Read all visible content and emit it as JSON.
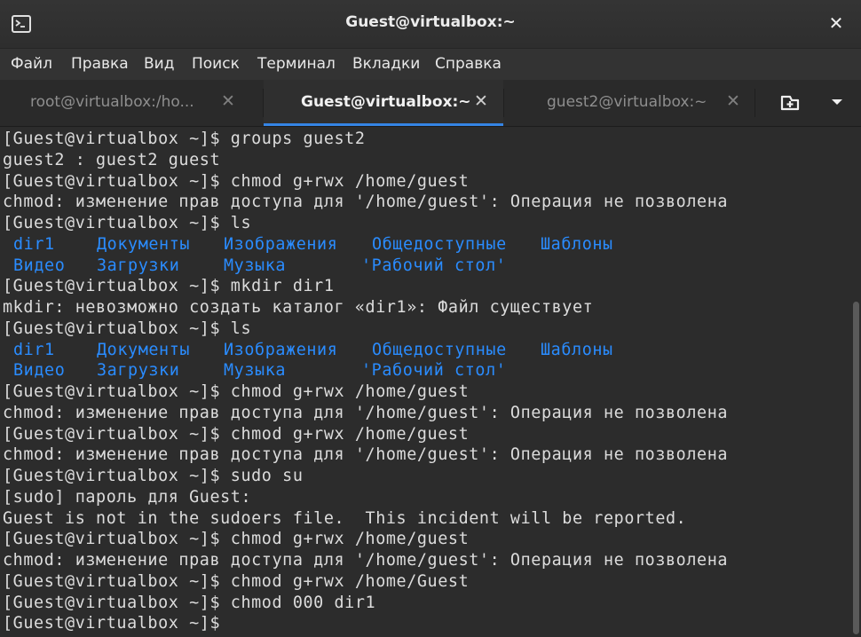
{
  "window": {
    "title": "Guest@virtualbox:~",
    "icon": "terminal-icon",
    "close_label": "✕"
  },
  "menu": [
    "Файл",
    "Правка",
    "Вид",
    "Поиск",
    "Терминал",
    "Вкладки",
    "Справка"
  ],
  "tabs": [
    {
      "label": "root@virtualbox:/ho...",
      "active": false,
      "close": "✕"
    },
    {
      "label": "Guest@virtualbox:~",
      "active": true,
      "close": "✕"
    },
    {
      "label": "guest2@virtualbox:~",
      "active": false,
      "close": "✕"
    }
  ],
  "tab_controls": {
    "new_tab_icon": "new-tab-icon",
    "menu_icon": "chevron-down-icon"
  },
  "colors": {
    "directory": "#2a8cff",
    "text": "#dcdcdc",
    "background": "#2c2c2c",
    "accent": "#3584e4"
  },
  "terminal": {
    "lines": [
      "[Guest@virtualbox ~]$ groups guest2",
      "guest2 : guest2 guest",
      "[Guest@virtualbox ~]$ chmod g+rwx /home/guest",
      "chmod: изменение прав доступа для '/home/guest': Операция не позволена",
      "[Guest@virtualbox ~]$ ls",
      "",
      "",
      "[Guest@virtualbox ~]$ mkdir dir1",
      "mkdir: невозможно создать каталог «dir1»: Файл существует",
      "[Guest@virtualbox ~]$ ls",
      "",
      "",
      "[Guest@virtualbox ~]$ chmod g+rwx /home/guest",
      "chmod: изменение прав доступа для '/home/guest': Операция не позволена",
      "[Guest@virtualbox ~]$ chmod g+rwx /home/guest",
      "chmod: изменение прав доступа для '/home/guest': Операция не позволена",
      "[Guest@virtualbox ~]$ sudo su",
      "[sudo] пароль для Guest:",
      "Guest is not in the sudoers file.  This incident will be reported.",
      "[Guest@virtualbox ~]$ chmod g+rwx /home/guest",
      "chmod: изменение прав доступа для '/home/guest': Операция не позволена",
      "[Guest@virtualbox ~]$ chmod g+rwx /home/Guest",
      "[Guest@virtualbox ~]$ chmod 000 dir1",
      "[Guest@virtualbox ~]$ "
    ],
    "ls_output": [
      [
        "dir1",
        "Документы",
        "Изображения",
        "Общедоступные",
        "Шаблоны"
      ],
      [
        "Видео",
        "Загрузки",
        "Музыка",
        "'Рабочий стол'"
      ]
    ]
  }
}
